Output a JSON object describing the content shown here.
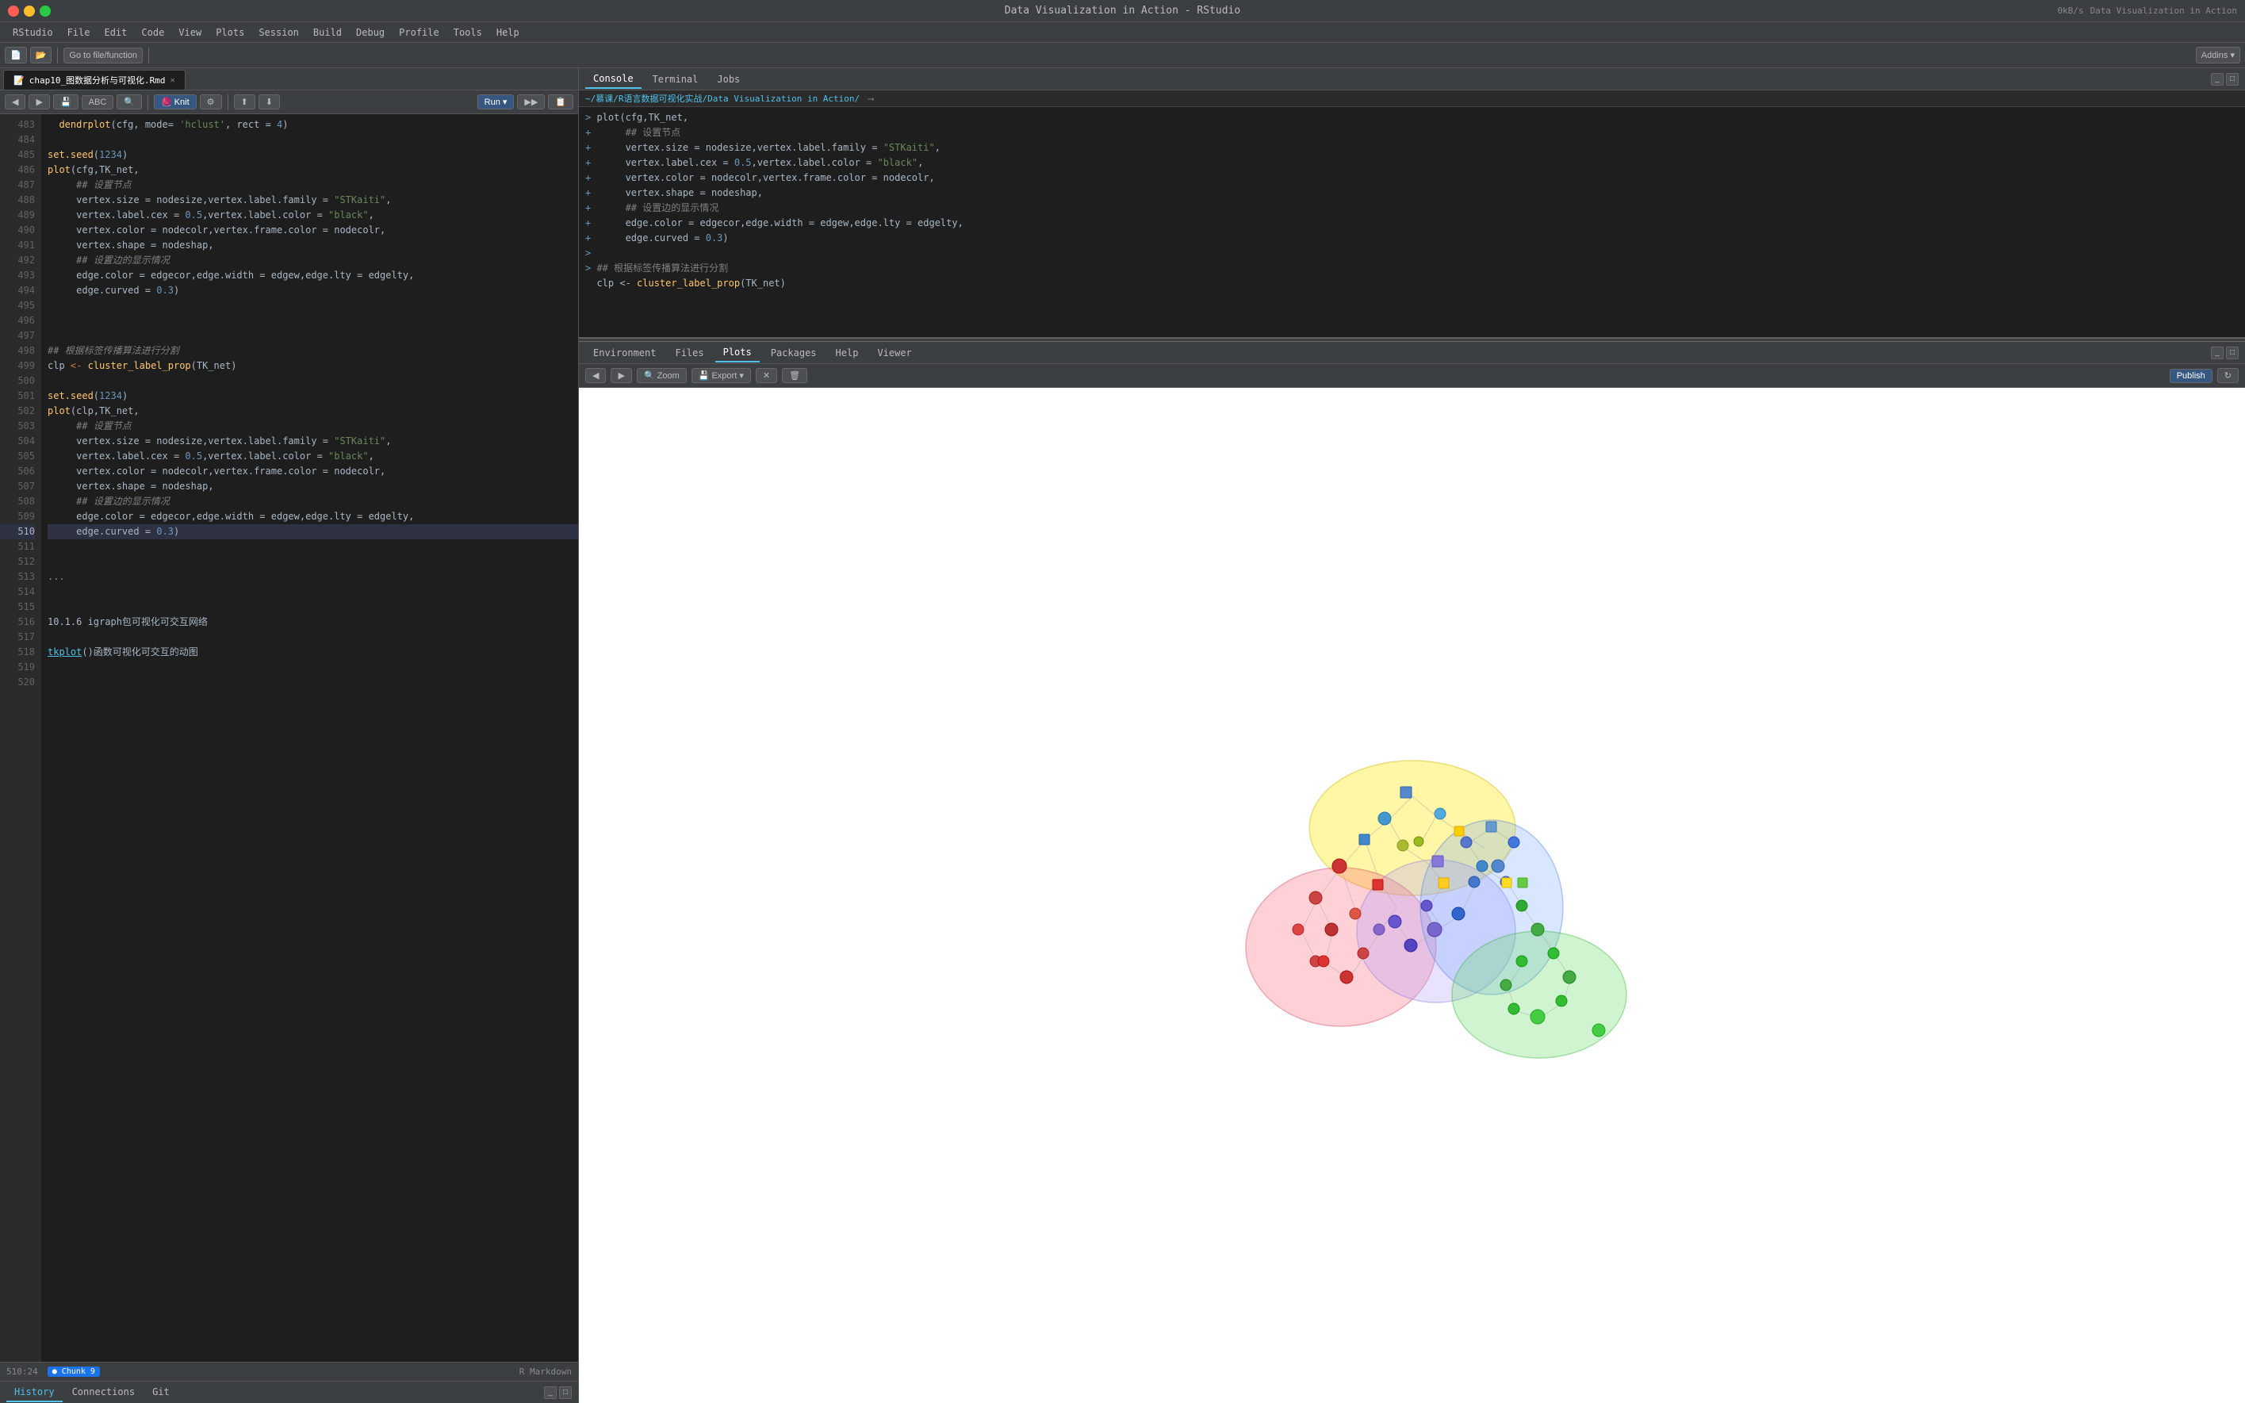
{
  "titleBar": {
    "title": "Data Visualization in Action - RStudio",
    "networkSpeed": "0kB/s",
    "rightLabel": "Data Visualization in Action"
  },
  "menuBar": {
    "items": [
      "RStudio",
      "File",
      "Edit",
      "Code",
      "View",
      "Plots",
      "Session",
      "Build",
      "Debug",
      "Profile",
      "Tools",
      "Help"
    ]
  },
  "toolbar": {
    "gotoFile": "Go to file/function",
    "addins": "Addins ▾"
  },
  "editor": {
    "tabName": "chap10_图数据分析与可视化.Rmd",
    "lines": [
      {
        "num": 483,
        "text": "  dendrplot(cfg, mode= 'hclust', rect = 4)"
      },
      {
        "num": 484,
        "text": ""
      },
      {
        "num": 485,
        "text": "set.seed(1234)"
      },
      {
        "num": 486,
        "text": "plot(cfg,TK_net,"
      },
      {
        "num": 487,
        "text": "     ## 设置节点"
      },
      {
        "num": 488,
        "text": "     vertex.size = nodesize,vertex.label.family = \"STKaiti\","
      },
      {
        "num": 489,
        "text": "     vertex.label.cex = 0.5,vertex.label.color = \"black\","
      },
      {
        "num": 490,
        "text": "     vertex.color = nodecolr,vertex.frame.color = nodecolr,"
      },
      {
        "num": 491,
        "text": "     vertex.shape = nodeshap,"
      },
      {
        "num": 492,
        "text": "     ## 设置边的显示情况"
      },
      {
        "num": 493,
        "text": "     edge.color = edgecor,edge.width = edgew,edge.lty = edgelty,"
      },
      {
        "num": 494,
        "text": "     edge.curved = 0.3)"
      },
      {
        "num": 495,
        "text": ""
      },
      {
        "num": 496,
        "text": ""
      },
      {
        "num": 497,
        "text": ""
      },
      {
        "num": 498,
        "text": "## 根据标签传播算法进行分割"
      },
      {
        "num": 499,
        "text": "clp <- cluster_label_prop(TK_net)"
      },
      {
        "num": 500,
        "text": ""
      },
      {
        "num": 501,
        "text": "set.seed(1234)"
      },
      {
        "num": 502,
        "text": "plot(clp,TK_net,"
      },
      {
        "num": 503,
        "text": "     ## 设置节点"
      },
      {
        "num": 504,
        "text": "     vertex.size = nodesize,vertex.label.family = \"STKaiti\","
      },
      {
        "num": 505,
        "text": "     vertex.label.cex = 0.5,vertex.label.color = \"black\","
      },
      {
        "num": 506,
        "text": "     vertex.color = nodecolr,vertex.frame.color = nodecolr,"
      },
      {
        "num": 507,
        "text": "     vertex.shape = nodeshap,"
      },
      {
        "num": 508,
        "text": "     ## 设置边的显示情况"
      },
      {
        "num": 509,
        "text": "     edge.color = edgecor,edge.width = edgew,edge.lty = edgelty,"
      },
      {
        "num": 510,
        "text": "     edge.curved = 0.3)"
      },
      {
        "num": 511,
        "text": ""
      },
      {
        "num": 512,
        "text": ""
      },
      {
        "num": 513,
        "text": "..."
      },
      {
        "num": 514,
        "text": ""
      },
      {
        "num": 515,
        "text": ""
      },
      {
        "num": 516,
        "text": "10.1.6 igraph包可视化可交互网络"
      },
      {
        "num": 517,
        "text": ""
      },
      {
        "num": 518,
        "text": "tkplot()函数可视化可交互的动图"
      },
      {
        "num": 519,
        "text": ""
      },
      {
        "num": 520,
        "text": ""
      }
    ],
    "cursorLine": "510:24",
    "chunkName": "Chunk 9",
    "fileType": "R Markdown"
  },
  "console": {
    "tabs": [
      "Console",
      "Terminal",
      "Jobs"
    ],
    "activeTab": "Console",
    "path": "~/慕课/R语言数据可视化实战/Data Visualization in Action/",
    "lines": [
      "> plot(cfg,TK_net,",
      "+      ## 设置节点",
      "+      vertex.size = nodesize,vertex.label.family = \"STKaiti\",",
      "+      vertex.label.cex = 0.5,vertex.label.color = \"black\",",
      "+      vertex.color = nodecolr,vertex.frame.color = nodecolr,",
      "+      vertex.shape = nodeshap,",
      "+      ## 设置边的显示情况",
      "+      edge.color = edgecor,edge.width = edgew,edge.lty = edgelty,",
      "+      edge.curved = 0.3)",
      ">",
      "> ## 根据标签传播算法进行分割",
      "  clp <- cluster_label_prop(TK_net)"
    ]
  },
  "plots": {
    "tabs": [
      "Environment",
      "Files",
      "Plots",
      "Packages",
      "Help",
      "Viewer"
    ],
    "activeTab": "Plots",
    "toolbar": {
      "zoom": "Zoom",
      "export": "Export ▾",
      "publish": "Publish"
    }
  },
  "bottomTabs": {
    "items": [
      "History",
      "Connections",
      "Git"
    ],
    "activeTab": "History"
  }
}
